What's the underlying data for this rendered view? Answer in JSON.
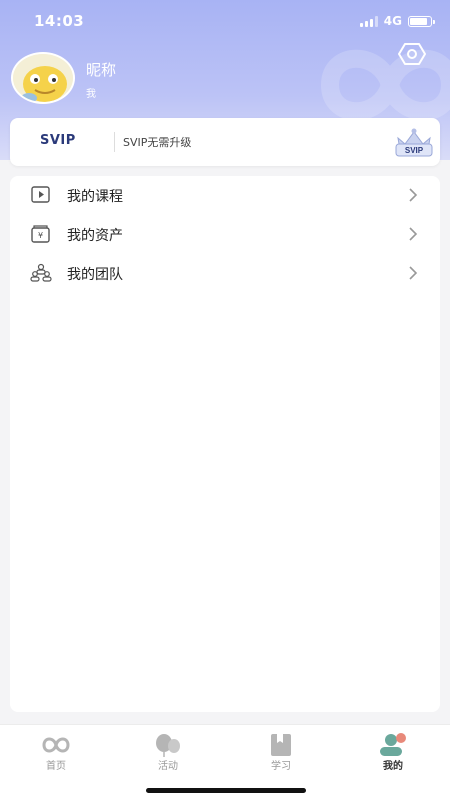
{
  "status_bar": {
    "time": "14:03",
    "network": "4G",
    "battery_level": 0.85
  },
  "profile": {
    "nickname": "昵称",
    "subtitle": "我",
    "avatar": "cartoon-yellow-character-avatar"
  },
  "header": {
    "settings_icon": "settings-hexagon-icon"
  },
  "svip": {
    "label": "SVIP",
    "description": "SVIP无需升级",
    "badge_text": "SVIP",
    "badge_icon": "crown-badge-icon"
  },
  "menu": {
    "items": [
      {
        "label": "我的课程",
        "icon": "video-play-icon"
      },
      {
        "label": "我的资产",
        "icon": "wallet-yen-icon"
      },
      {
        "label": "我的团队",
        "icon": "team-icon"
      }
    ]
  },
  "tabbar": {
    "tabs": [
      {
        "label": "首页",
        "icon": "home-infinity-icon",
        "active": false
      },
      {
        "label": "活动",
        "icon": "activity-balloons-icon",
        "active": false
      },
      {
        "label": "学习",
        "icon": "bookmark-book-icon",
        "active": false
      },
      {
        "label": "我的",
        "icon": "profile-user-icon",
        "active": true
      }
    ]
  },
  "colors": {
    "header_gradient_top": "#a8b3f4",
    "svip_text": "#2b3a7a",
    "active_tab_accent": "#e8897a"
  }
}
